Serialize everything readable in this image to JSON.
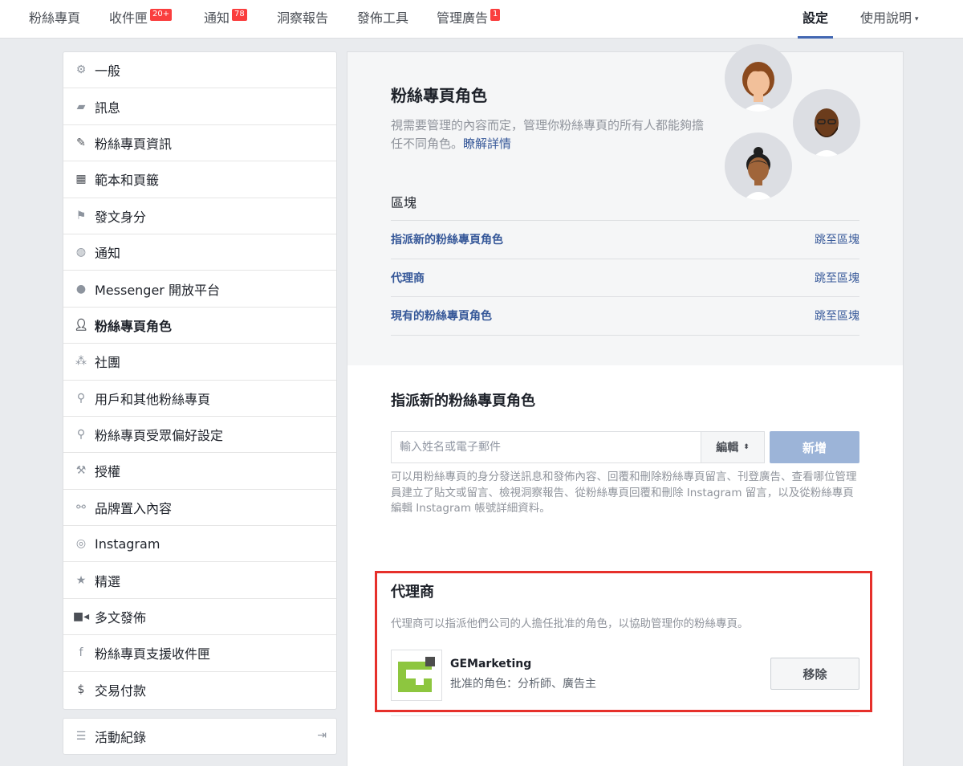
{
  "topnav": {
    "items": [
      {
        "label": "粉絲專頁"
      },
      {
        "label": "收件匣",
        "badge": "20+"
      },
      {
        "label": "通知",
        "badge": "78"
      },
      {
        "label": "洞察報告"
      },
      {
        "label": "發佈工具"
      },
      {
        "label": "管理廣告",
        "badge": "1"
      }
    ],
    "settings": "設定",
    "help": "使用說明"
  },
  "sidebar": {
    "items": [
      {
        "label": "一般",
        "icon": "gear-icon"
      },
      {
        "label": "訊息",
        "icon": "chat-icon"
      },
      {
        "label": "粉絲專頁資訊",
        "icon": "pencil-icon"
      },
      {
        "label": "範本和頁籤",
        "icon": "grid-icon"
      },
      {
        "label": "發文身分",
        "icon": "flag-icon"
      },
      {
        "label": "通知",
        "icon": "globe-icon"
      },
      {
        "label": "Messenger 開放平台",
        "icon": "messenger-icon"
      },
      {
        "label": "粉絲專頁角色",
        "icon": "person-icon",
        "active": true
      },
      {
        "label": "社團",
        "icon": "group-icon"
      },
      {
        "label": "用戶和其他粉絲專頁",
        "icon": "person-star-icon"
      },
      {
        "label": "粉絲專頁受眾偏好設定",
        "icon": "person-star-icon"
      },
      {
        "label": "授權",
        "icon": "wrench-icon"
      },
      {
        "label": "品牌置入內容",
        "icon": "handshake-icon"
      },
      {
        "label": "Instagram",
        "icon": "instagram-icon"
      },
      {
        "label": "精選",
        "icon": "star-icon"
      },
      {
        "label": "多文發佈",
        "icon": "video-icon"
      },
      {
        "label": "粉絲專頁支援收件匣",
        "icon": "facebook-icon"
      },
      {
        "label": "交易付款",
        "icon": "dollar-icon"
      }
    ],
    "activity": "活動紀錄"
  },
  "main": {
    "title": "粉絲專頁角色",
    "desc": "視需要管理的內容而定，管理你粉絲專頁的所有人都能夠擔任不同角色。",
    "learn_more": "瞭解詳情",
    "blocks_label": "區塊",
    "blocks": [
      {
        "label": "指派新的粉絲專頁角色",
        "link": "跳至區塊"
      },
      {
        "label": "代理商",
        "link": "跳至區塊"
      },
      {
        "label": "現有的粉絲專頁角色",
        "link": "跳至區塊"
      }
    ],
    "assign": {
      "title": "指派新的粉絲專頁角色",
      "placeholder": "輸入姓名或電子郵件",
      "role": "編輯",
      "add": "新增",
      "note": "可以用粉絲專頁的身分發送訊息和發佈內容、回覆和刪除粉絲專頁留言、刊登廣告、查看哪位管理員建立了貼文或留言、檢視洞察報告、從粉絲專頁回覆和刪除 Instagram 留言，以及從粉絲專頁編輯 Instagram 帳號詳細資料。"
    },
    "agency": {
      "title": "代理商",
      "desc": "代理商可以指派他們公司的人擔任批准的角色，以協助管理你的粉絲專頁。",
      "name": "GEMarketing",
      "role": "批准的角色：分析師、廣告主",
      "remove": "移除"
    }
  },
  "colors": {
    "link": "#365899",
    "accent": "#4267b2",
    "highlight_border": "#e6302b",
    "logo_green": "#8dc63f"
  }
}
